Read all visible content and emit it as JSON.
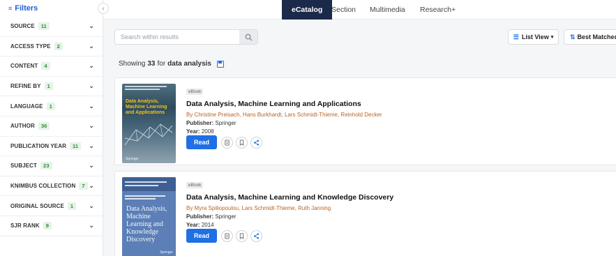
{
  "sidebar": {
    "title": "Filters",
    "facets": [
      {
        "label": "SOURCE",
        "count": "11"
      },
      {
        "label": "ACCESS TYPE",
        "count": "2"
      },
      {
        "label": "CONTENT",
        "count": "4"
      },
      {
        "label": "REFINE BY",
        "count": "1"
      },
      {
        "label": "LANGUAGE",
        "count": "1"
      },
      {
        "label": "AUTHOR",
        "count": "36"
      },
      {
        "label": "PUBLICATION YEAR",
        "count": "11"
      },
      {
        "label": "SUBJECT",
        "count": "23"
      },
      {
        "label": "KNIMBUS COLLECTION",
        "count": "7"
      },
      {
        "label": "ORIGINAL SOURCE",
        "count": "1"
      },
      {
        "label": "SJR RANK",
        "count": "9"
      }
    ]
  },
  "tabs": [
    "eCatalog",
    "Section",
    "Multimedia",
    "Research+"
  ],
  "search": {
    "placeholder": "Search within results",
    "value": ""
  },
  "toolbar": {
    "list_view": "List View",
    "sort": "Best Matched"
  },
  "summary": {
    "prefix": "Showing",
    "count": "33",
    "mid": "for",
    "query": "data analysis"
  },
  "results": [
    {
      "type": "eBook",
      "title": "Data Analysis, Machine Learning and Applications",
      "authors": "By Christine Preisach, Hans Burkhardt, Lars Schmidt-Thieme, Reinhold Decker",
      "publisher_label": "Publisher:",
      "publisher": "Springer",
      "year_label": "Year:",
      "year": "2008",
      "read": "Read",
      "cover_text": "Data Analysis, Machine Learning and Applications",
      "cover_publisher": "Springer"
    },
    {
      "type": "eBook",
      "title": "Data Analysis, Machine Learning and Knowledge Discovery",
      "authors": "By Myra Spiliopoulou, Lars Schmidt-Thieme, Ruth Janning",
      "publisher_label": "Publisher:",
      "publisher": "Springer",
      "year_label": "Year:",
      "year": "2014",
      "read": "Read",
      "cover_text": "Data Analysis, Machine Learning and Knowledge Discovery",
      "cover_publisher": "Springer"
    }
  ],
  "colors": {
    "accent": "#1f6fe5",
    "nav_active": "#1b2a4a",
    "author": "#b5652a",
    "badge_bg": "#e4f4e6",
    "badge_text": "#2e8b3c"
  }
}
